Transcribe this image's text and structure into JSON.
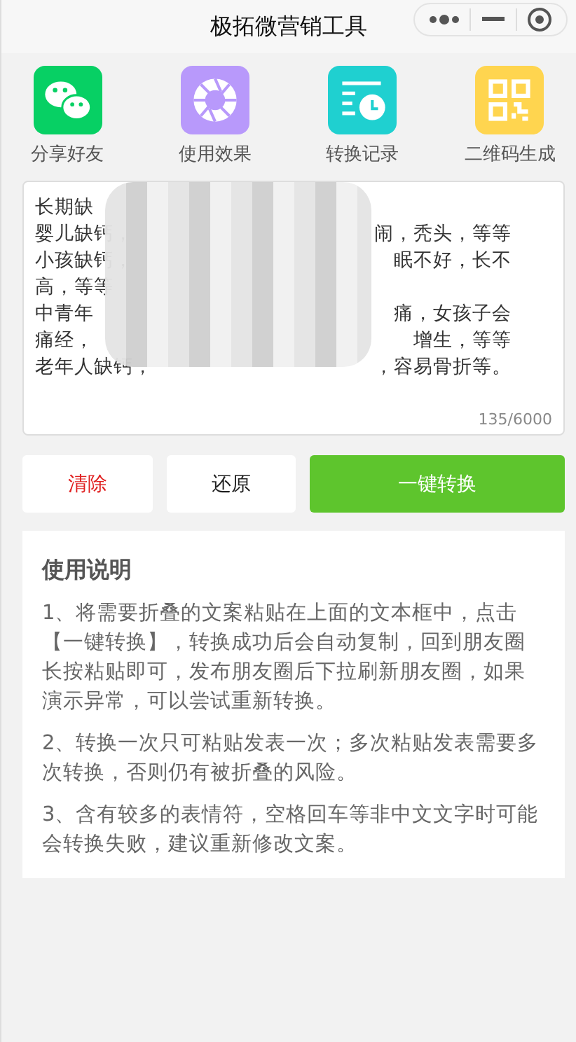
{
  "window": {
    "title": "极拓微营销工具"
  },
  "shortcuts": [
    {
      "label": "分享好友",
      "kind": "wechat",
      "color": "#07d064"
    },
    {
      "label": "使用效果",
      "kind": "aperture",
      "color": "#b899fb"
    },
    {
      "label": "转换记录",
      "kind": "history",
      "color": "#1fd0d0"
    },
    {
      "label": "二维码生成",
      "kind": "qrcode",
      "color": "#ffd54f"
    }
  ],
  "editor": {
    "lines": [
      {
        "left": "长期缺"
      },
      {
        "left": "婴儿缺钙，",
        "right": "闹，秃头，等等"
      },
      {
        "left": "小孩缺钙，",
        "right": "眠不好，长不"
      },
      {
        "left": "高，等等"
      },
      {
        "left": "中青年",
        "right": "痛，女孩子会"
      },
      {
        "left": "痛经，",
        "right": "增生，等等"
      },
      {
        "left": "老年人缺钙，",
        "right": "，容易骨折等。"
      }
    ],
    "counter": "135/6000"
  },
  "buttons": [
    {
      "label": "清除",
      "kind": "danger"
    },
    {
      "label": "还原",
      "kind": "plain"
    },
    {
      "label": "一键转换",
      "kind": "primary"
    }
  ],
  "instructions": {
    "title": "使用说明",
    "paragraphs": [
      "1、将需要折叠的文案粘贴在上面的文本框中，点击【一键转换】，转换成功后会自动复制，回到朋友圈长按粘贴即可，发布朋友圈后下拉刷新朋友圈，如果演示异常，可以尝试重新转换。",
      "2、转换一次只可粘贴发表一次；多次粘贴发表需要多次转换，否则仍有被折叠的风险。",
      "3、含有较多的表情符，空格回车等非中文文字时可能会转换失败，建议重新修改文案。"
    ]
  }
}
